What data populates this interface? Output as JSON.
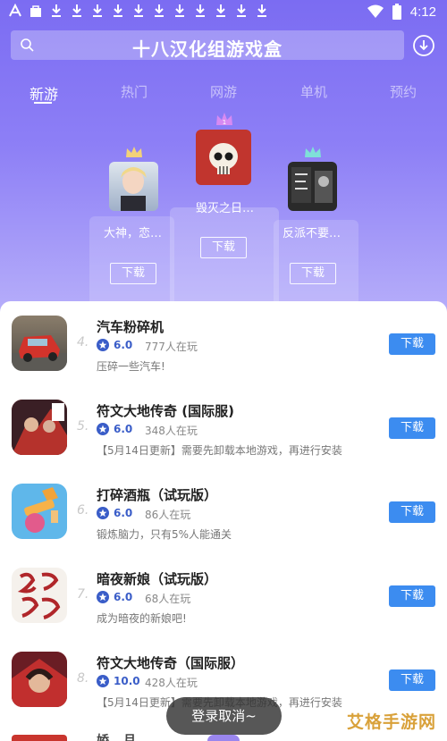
{
  "status": {
    "time": "4:12"
  },
  "header": {
    "title": "十八汉化组游戏盒"
  },
  "tabs": [
    {
      "label": "新游"
    },
    {
      "label": "热门"
    },
    {
      "label": "网游"
    },
    {
      "label": "单机"
    },
    {
      "label": "预约"
    }
  ],
  "podium": {
    "first": {
      "rank": "1",
      "name": "毁灭之日…",
      "button": "下载"
    },
    "second": {
      "rank": "2",
      "name": "大神，恋…",
      "button": "下载"
    },
    "third": {
      "rank": "3",
      "name": "反派不要…",
      "button": "下载"
    }
  },
  "list": [
    {
      "rank": "4.",
      "name": "汽车粉碎机",
      "rating": "6.0",
      "players": "777人在玩",
      "desc": "压碎一些汽车!",
      "button": "下载"
    },
    {
      "rank": "5.",
      "name": "符文大地传奇 (国际服)",
      "rating": "6.0",
      "players": "348人在玩",
      "desc": "【5月14日更新】需要先卸载本地游戏，再进行安装",
      "button": "下载"
    },
    {
      "rank": "6.",
      "name": "打碎酒瓶（试玩版）",
      "rating": "6.0",
      "players": "86人在玩",
      "desc": "锻炼脑力，只有5%人能通关",
      "button": "下载"
    },
    {
      "rank": "7.",
      "name": "暗夜新娘（试玩版）",
      "rating": "6.0",
      "players": "68人在玩",
      "desc": "成为暗夜的新娘吧!",
      "button": "下载"
    },
    {
      "rank": "8.",
      "name": "符文大地传奇（国际服）",
      "rating": "10.0",
      "players": "428人在玩",
      "desc": "【5月14日更新】需要先卸载本地游戏，再进行安装",
      "button": "下载"
    }
  ],
  "peek": {
    "name": "娇...月..."
  },
  "toast": {
    "text": "登录取消~"
  },
  "watermark": {
    "text": "艾格手游网"
  },
  "colors": {
    "accent": "#3c8cf0",
    "header_gradient_top": "#7b6cf2",
    "rating": "#3a5dc8"
  }
}
